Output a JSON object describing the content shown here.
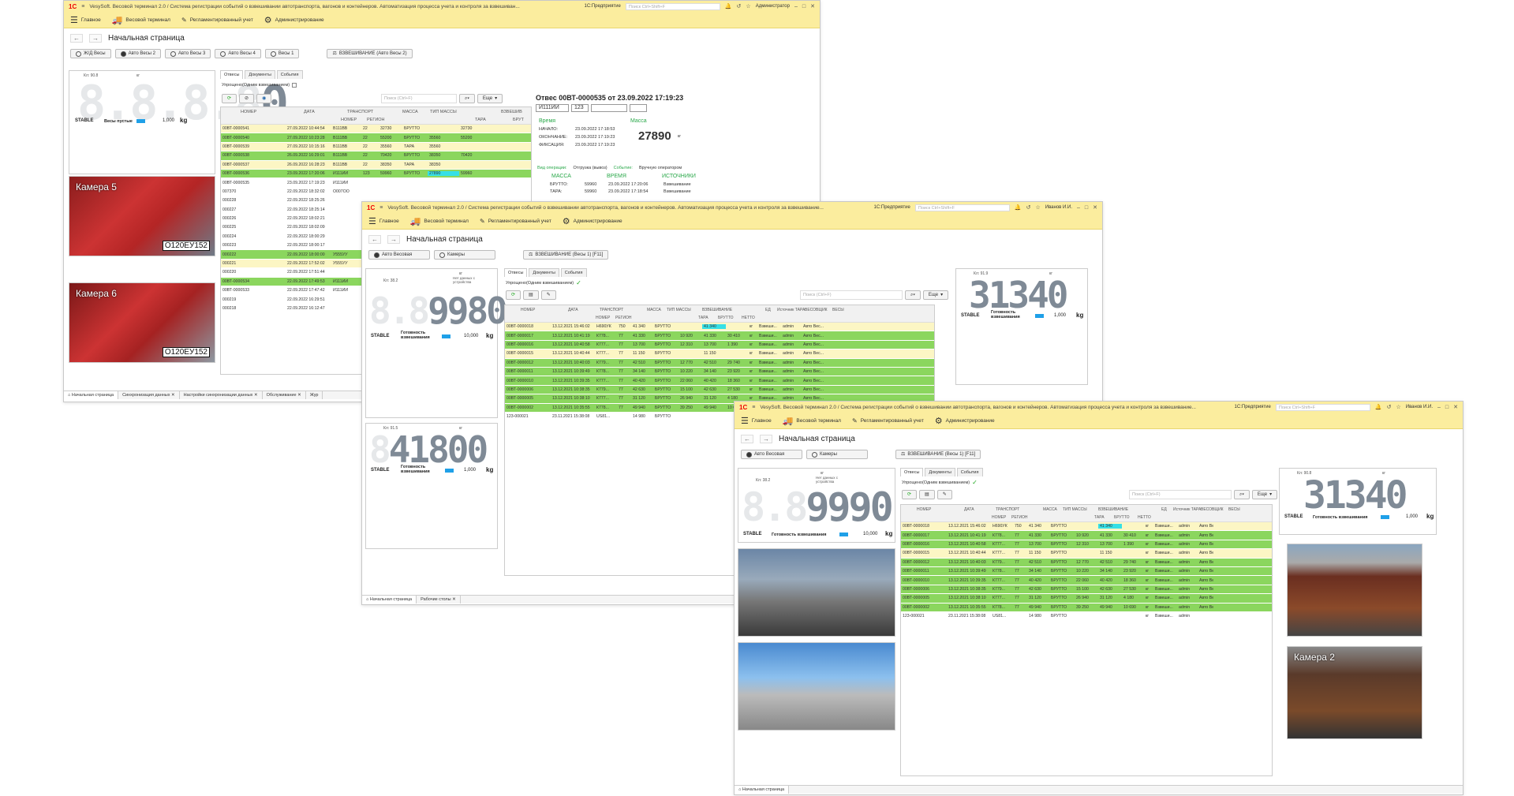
{
  "w1": {
    "title": "VesySoft. Весовой терминал 2.0 / Система регистрации событий о взвешивании автотранспорта, вагонов и контейнеров. Автоматизация процесса учета и контроля за взвешиван...",
    "app": "1С:Предприятие",
    "search": "Поиск Ctrl+Shift+F",
    "user": "Администратор",
    "menu": [
      "Главное",
      "Весовой терминал",
      "Регламентированный учет",
      "Администрирование"
    ],
    "page_title": "Начальная страница",
    "scale_buttons": [
      "Ж/Д Весы",
      "Авто Весы 2",
      "Авто Весы 3",
      "Авто Весы 4",
      "Весы 1"
    ],
    "weigh_button": "ВЗВЕШИВАНИЕ (Авто Весы 2)",
    "scale": {
      "hdr": "Кл: 90.8",
      "unit_hdr": "кг",
      "ghost": "8.8.8.8",
      "value": "0",
      "stable": "STABLE",
      "status": "Весы пустые",
      "step": "1,000",
      "unit": "kg"
    },
    "cams": [
      "Камера 5",
      "Камера 6"
    ],
    "plates": [
      "О120ЕУ152",
      "О120ЕУ152"
    ],
    "tabs": [
      "Отвесы",
      "Документы",
      "События"
    ],
    "simplified": "Упрощено(Одним взвешиванием)",
    "search_ph": "Поиск (Ctrl+F)",
    "more": "Еще",
    "cols": [
      "НОМЕР",
      "ДАТА",
      "ТРАНСПОРТ",
      "МАССА",
      "ТИП МАССЫ",
      "ВЗВЕШИВ"
    ],
    "subcols": [
      "НОМЕР",
      "РЕГИОН",
      "ТАРА",
      "БРУТ"
    ],
    "rows": [
      {
        "n": "00ВТ-0000541",
        "d": "27.09.2022 10:44:54",
        "t": "В111ВВ",
        "r": "22",
        "m": "32730",
        "k": "БРУТТО",
        "tara": "",
        "br": "32730",
        "c": "yellow"
      },
      {
        "n": "00ВТ-0000540",
        "d": "27.09.2022 10:23:28",
        "t": "В111ВВ",
        "r": "22",
        "m": "55200",
        "k": "БРУТТО",
        "tara": "35560",
        "br": "55200",
        "c": "green"
      },
      {
        "n": "00ВТ-0000539",
        "d": "27.09.2022 10:15:16",
        "t": "В111ВВ",
        "r": "22",
        "m": "35560",
        "k": "ТАРА",
        "tara": "35560",
        "br": "",
        "c": "yellow"
      },
      {
        "n": "00ВТ-0000538",
        "d": "26.09.2022 16:29:01",
        "t": "В111ВВ",
        "r": "22",
        "m": "70420",
        "k": "БРУТТО",
        "tara": "38350",
        "br": "70420",
        "c": "green"
      },
      {
        "n": "00ВТ-0000537",
        "d": "26.09.2022 16:28:23",
        "t": "В111ВВ",
        "r": "22",
        "m": "38350",
        "k": "ТАРА",
        "tara": "38350",
        "br": "",
        "c": "yellow"
      },
      {
        "n": "00ВТ-0000536",
        "d": "23.09.2022 17:20:06",
        "t": "И111ИИ",
        "r": "123",
        "m": "59960",
        "k": "БРУТТО",
        "tara": "27890",
        "br": "59960",
        "c": "green"
      },
      {
        "n": "00ВТ-0000535",
        "d": "23.09.2022 17:19:23",
        "t": "И111ИИ",
        "r": "",
        "m": "",
        "k": "",
        "tara": "",
        "br": "",
        "c": "white"
      },
      {
        "n": "007370",
        "d": "22.09.2022 18:32:02",
        "t": "О007ОО",
        "r": "",
        "m": "",
        "k": "",
        "tara": "",
        "br": "",
        "c": "white"
      },
      {
        "n": "000228",
        "d": "22.09.2022 18:25:26",
        "t": "",
        "r": "",
        "m": "",
        "k": "",
        "tara": "",
        "br": "",
        "c": "white"
      },
      {
        "n": "000227",
        "d": "22.09.2022 18:25:14",
        "t": "",
        "r": "",
        "m": "",
        "k": "",
        "tara": "",
        "br": "",
        "c": "white"
      },
      {
        "n": "000226",
        "d": "22.09.2022 18:02:21",
        "t": "",
        "r": "",
        "m": "",
        "k": "",
        "tara": "",
        "br": "",
        "c": "white"
      },
      {
        "n": "000225",
        "d": "22.09.2022 18:02:09",
        "t": "",
        "r": "",
        "m": "",
        "k": "",
        "tara": "",
        "br": "",
        "c": "white"
      },
      {
        "n": "000224",
        "d": "22.09.2022 18:00:29",
        "t": "",
        "r": "",
        "m": "",
        "k": "",
        "tara": "",
        "br": "",
        "c": "white"
      },
      {
        "n": "000223",
        "d": "22.09.2022 18:00:17",
        "t": "",
        "r": "",
        "m": "",
        "k": "",
        "tara": "",
        "br": "",
        "c": "white"
      },
      {
        "n": "000222",
        "d": "22.09.2022 18:00:00",
        "t": "У555УУ",
        "r": "",
        "m": "",
        "k": "",
        "tara": "",
        "br": "",
        "c": "green"
      },
      {
        "n": "000221",
        "d": "22.09.2022 17:52:02",
        "t": "У555УУ",
        "r": "",
        "m": "",
        "k": "",
        "tara": "",
        "br": "",
        "c": "yellow"
      },
      {
        "n": "000220",
        "d": "22.09.2022 17:51:44",
        "t": "",
        "r": "",
        "m": "",
        "k": "",
        "tara": "",
        "br": "",
        "c": "white"
      },
      {
        "n": "00ВТ-0000534",
        "d": "22.09.2022 17:49:53",
        "t": "И111ИИ",
        "r": "",
        "m": "",
        "k": "",
        "tara": "",
        "br": "",
        "c": "green"
      },
      {
        "n": "00ВТ-0000533",
        "d": "22.09.2022 17:47:42",
        "t": "И111ИИ",
        "r": "",
        "m": "",
        "k": "",
        "tara": "",
        "br": "",
        "c": "white"
      },
      {
        "n": "000219",
        "d": "22.09.2022 16:29:51",
        "t": "",
        "r": "",
        "m": "",
        "k": "",
        "tara": "",
        "br": "",
        "c": "white"
      },
      {
        "n": "000218",
        "d": "22.09.2022 16:12:47",
        "t": "",
        "r": "",
        "m": "",
        "k": "",
        "tara": "",
        "br": "",
        "c": "white"
      }
    ],
    "detail": {
      "title": "Отвес 00ВТ-0000535 от 23.09.2022 17:19:23",
      "plate": "И111ИИ",
      "region": "123",
      "time": "Время",
      "mass": "Масса",
      "start": "НАЧАЛО:",
      "start_v": "23.09.2022 17:18:53",
      "end": "ОКОНЧАНИЕ:",
      "end_v": "23.09.2022 17:19:23",
      "fix": "ФИКСАЦИЯ:",
      "fix_v": "23.09.2022 17:19:23",
      "mass_v": "27890",
      "unit": "кг",
      "op": "Вид операции:",
      "op_v": "Отгрузка (вывоз)",
      "ev": "Событие:",
      "ev_v": "Вручную оператором",
      "h1": "МАССА",
      "h2": "ВРЕМЯ",
      "h3": "ИСТОЧНИКИ",
      "l1": "БРУТТО:",
      "l1v": "59960",
      "l1t": "23.09.2022 17:20:06",
      "l1s": "Взвешивание",
      "l2": "ТАРА:",
      "l2v": "59960",
      "l2t": "23.09.2022 17:18:54",
      "l2s": "Взвешивание"
    },
    "footer": [
      "Начальная страница",
      "Синхронизация данных",
      "Настройки синхронизации данных",
      "Обслуживание",
      "Жур"
    ]
  },
  "w2": {
    "title": "VesySoft. Весовой терминал 2.0 / Система регистрации событий о взвешивании автотранспорта, вагонов и контейнеров. Автоматизация процесса учета и контроля за взвешивание...",
    "app": "1С:Предприятие",
    "search": "Поиск Ctrl+Shift+F",
    "user": "Иванов И.И.",
    "page_title": "Начальная страница",
    "mode_buttons": [
      "Авто Весовая",
      "Камеры"
    ],
    "weigh_button": "ВЗВЕШИВАНИЕ (Весы 1) [F11]",
    "scale1": {
      "hdr": "Кл: 38.2",
      "unit_hdr": "кг",
      "ghost": "8.8",
      "value": "9980",
      "note": "Нет данных с устройства",
      "stable": "STABLE",
      "status": "Готовность взвешивания",
      "step": "10,000",
      "unit": "kg"
    },
    "scale2": {
      "hdr": "Кл: 91.5",
      "unit_hdr": "кг",
      "ghost": "8",
      "value": "41800",
      "stable": "STABLE",
      "status": "Готовность взвешивания",
      "step": "1,000",
      "unit": "kg"
    },
    "scale3": {
      "hdr": "Кл: 91.9",
      "unit_hdr": "кг",
      "ghost": "",
      "value": "31340",
      "stable": "STABLE",
      "status": "Готовность взвешивания",
      "step": "1,000",
      "unit": "kg"
    },
    "tabs": [
      "Отвесы",
      "Документы",
      "События"
    ],
    "simplified": "Упрощено(Одним взвешиванием)",
    "search_ph": "Поиск (Ctrl+F)",
    "more": "Еще",
    "footer": [
      "Начальная страница",
      "Рабочие столы"
    ]
  },
  "w3": {
    "title": "VesySoft. Весовой терминал 2.0 / Система регистрации событий о взвешивании автотранспорта, вагонов и контейнеров. Автоматизация процесса учета и контроля за взвешивание...",
    "app": "1С:Предприятие",
    "search": "Поиск Ctrl+Shift+F",
    "user": "Иванов И.И.",
    "page_title": "Начальная страница",
    "scale1": {
      "hdr": "Кл: 38.2",
      "unit_hdr": "кг",
      "ghost": "8.8",
      "value": "9990",
      "note": "Нет данных с устройства",
      "stable": "STABLE",
      "status": "Готовность взвешивания",
      "step": "10,000",
      "unit": "kg"
    },
    "scale2": {
      "hdr": "Кл: 90.8",
      "unit_hdr": "кг",
      "ghost": "",
      "value": "31340",
      "stable": "STABLE",
      "status": "Готовность взвешивания",
      "step": "1,000",
      "unit": "kg"
    },
    "cam_label": "Камера 2",
    "footer": [
      "Начальная страница"
    ]
  },
  "grid2": {
    "cols": [
      "НОМЕР",
      "ДАТА",
      "ТРАНСПОРТ",
      "МАССА",
      "ТИП МАССЫ",
      "ВЗВЕШИВАНИЕ",
      "ЕД",
      "Источник ТАРА",
      "ВЕСОВЩИК",
      "ВЕСЫ"
    ],
    "subcols": [
      "НОМЕР",
      "РЕГИОН",
      "ТАРА",
      "БРУТТО",
      "НЕТТО"
    ],
    "rows": [
      {
        "n": "00ВТ-0000018",
        "d": "13.12.2021 15:46:02",
        "t": "Н690УК",
        "r": "750",
        "m": "41 340",
        "k": "БРУТТО",
        "tara": "",
        "br": "41 340",
        "net": "",
        "u": "кг",
        "s": "Взвеши...",
        "w": "admin",
        "sc": "Авто Вес...",
        "c": "yellow",
        "hl": true
      },
      {
        "n": "00ВТ-0000017",
        "d": "13.12.2021 10:41:19",
        "t": "К778...",
        "r": "77",
        "m": "41 330",
        "k": "БРУТТО",
        "tara": "10 920",
        "br": "41 330",
        "net": "30 410",
        "u": "кг",
        "s": "Взвеши...",
        "w": "admin",
        "sc": "Авто Вес...",
        "c": "green"
      },
      {
        "n": "00ВТ-0000016",
        "d": "13.12.2021 10:40:58",
        "t": "К777...",
        "r": "77",
        "m": "13 700",
        "k": "БРУТТО",
        "tara": "12 310",
        "br": "13 700",
        "net": "1 390",
        "u": "кг",
        "s": "Взвеши...",
        "w": "admin",
        "sc": "Авто Вес...",
        "c": "green"
      },
      {
        "n": "00ВТ-0000015",
        "d": "13.12.2021 10:40:44",
        "t": "К777...",
        "r": "77",
        "m": "11 150",
        "k": "БРУТТО",
        "tara": "",
        "br": "11 150",
        "net": "",
        "u": "кг",
        "s": "Взвеши...",
        "w": "admin",
        "sc": "Авто Вес...",
        "c": "yellow"
      },
      {
        "n": "00ВТ-0000012",
        "d": "13.12.2021 10:40:03",
        "t": "К779...",
        "r": "77",
        "m": "42 510",
        "k": "БРУТТО",
        "tara": "12 770",
        "br": "42 510",
        "net": "29 740",
        "u": "кг",
        "s": "Взвеши...",
        "w": "admin",
        "sc": "Авто Вес...",
        "c": "green"
      },
      {
        "n": "00ВТ-0000011",
        "d": "13.12.2021 10:39:49",
        "t": "К778...",
        "r": "77",
        "m": "34 140",
        "k": "БРУТТО",
        "tara": "10 220",
        "br": "34 140",
        "net": "23 920",
        "u": "кг",
        "s": "Взвеши...",
        "w": "admin",
        "sc": "Авто Вес...",
        "c": "green"
      },
      {
        "n": "00ВТ-0000010",
        "d": "13.12.2021 10:39:35",
        "t": "К777...",
        "r": "77",
        "m": "40 420",
        "k": "БРУТТО",
        "tara": "22 060",
        "br": "40 420",
        "net": "18 360",
        "u": "кг",
        "s": "Взвеши...",
        "w": "admin",
        "sc": "Авто Вес...",
        "c": "green"
      },
      {
        "n": "00ВТ-0000006",
        "d": "13.12.2021 10:38:35",
        "t": "К779...",
        "r": "77",
        "m": "42 630",
        "k": "БРУТТО",
        "tara": "15 100",
        "br": "42 630",
        "net": "27 530",
        "u": "кг",
        "s": "Взвеши...",
        "w": "admin",
        "sc": "Авто Вес...",
        "c": "green"
      },
      {
        "n": "00ВТ-0000005",
        "d": "13.12.2021 10:38:10",
        "t": "К777...",
        "r": "77",
        "m": "31 120",
        "k": "БРУТТО",
        "tara": "26 940",
        "br": "31 120",
        "net": "4 180",
        "u": "кг",
        "s": "Взвеши...",
        "w": "admin",
        "sc": "Авто Вес...",
        "c": "green"
      },
      {
        "n": "00ВТ-0000002",
        "d": "13.12.2021 10:35:55",
        "t": "К778...",
        "r": "77",
        "m": "49 940",
        "k": "БРУТТО",
        "tara": "39 250",
        "br": "49 940",
        "net": "10 690",
        "u": "кг",
        "s": "Взвеши...",
        "w": "admin",
        "sc": "Авто Вес...",
        "c": "green"
      },
      {
        "n": "123-000021",
        "d": "23.11.2021 15:38:08",
        "t": "US81...",
        "r": "",
        "m": "14 980",
        "k": "БРУТТО",
        "tara": "",
        "br": "",
        "net": "",
        "u": "кг",
        "s": "Взвеши...",
        "w": "admin",
        "sc": "",
        "c": "white"
      }
    ]
  }
}
